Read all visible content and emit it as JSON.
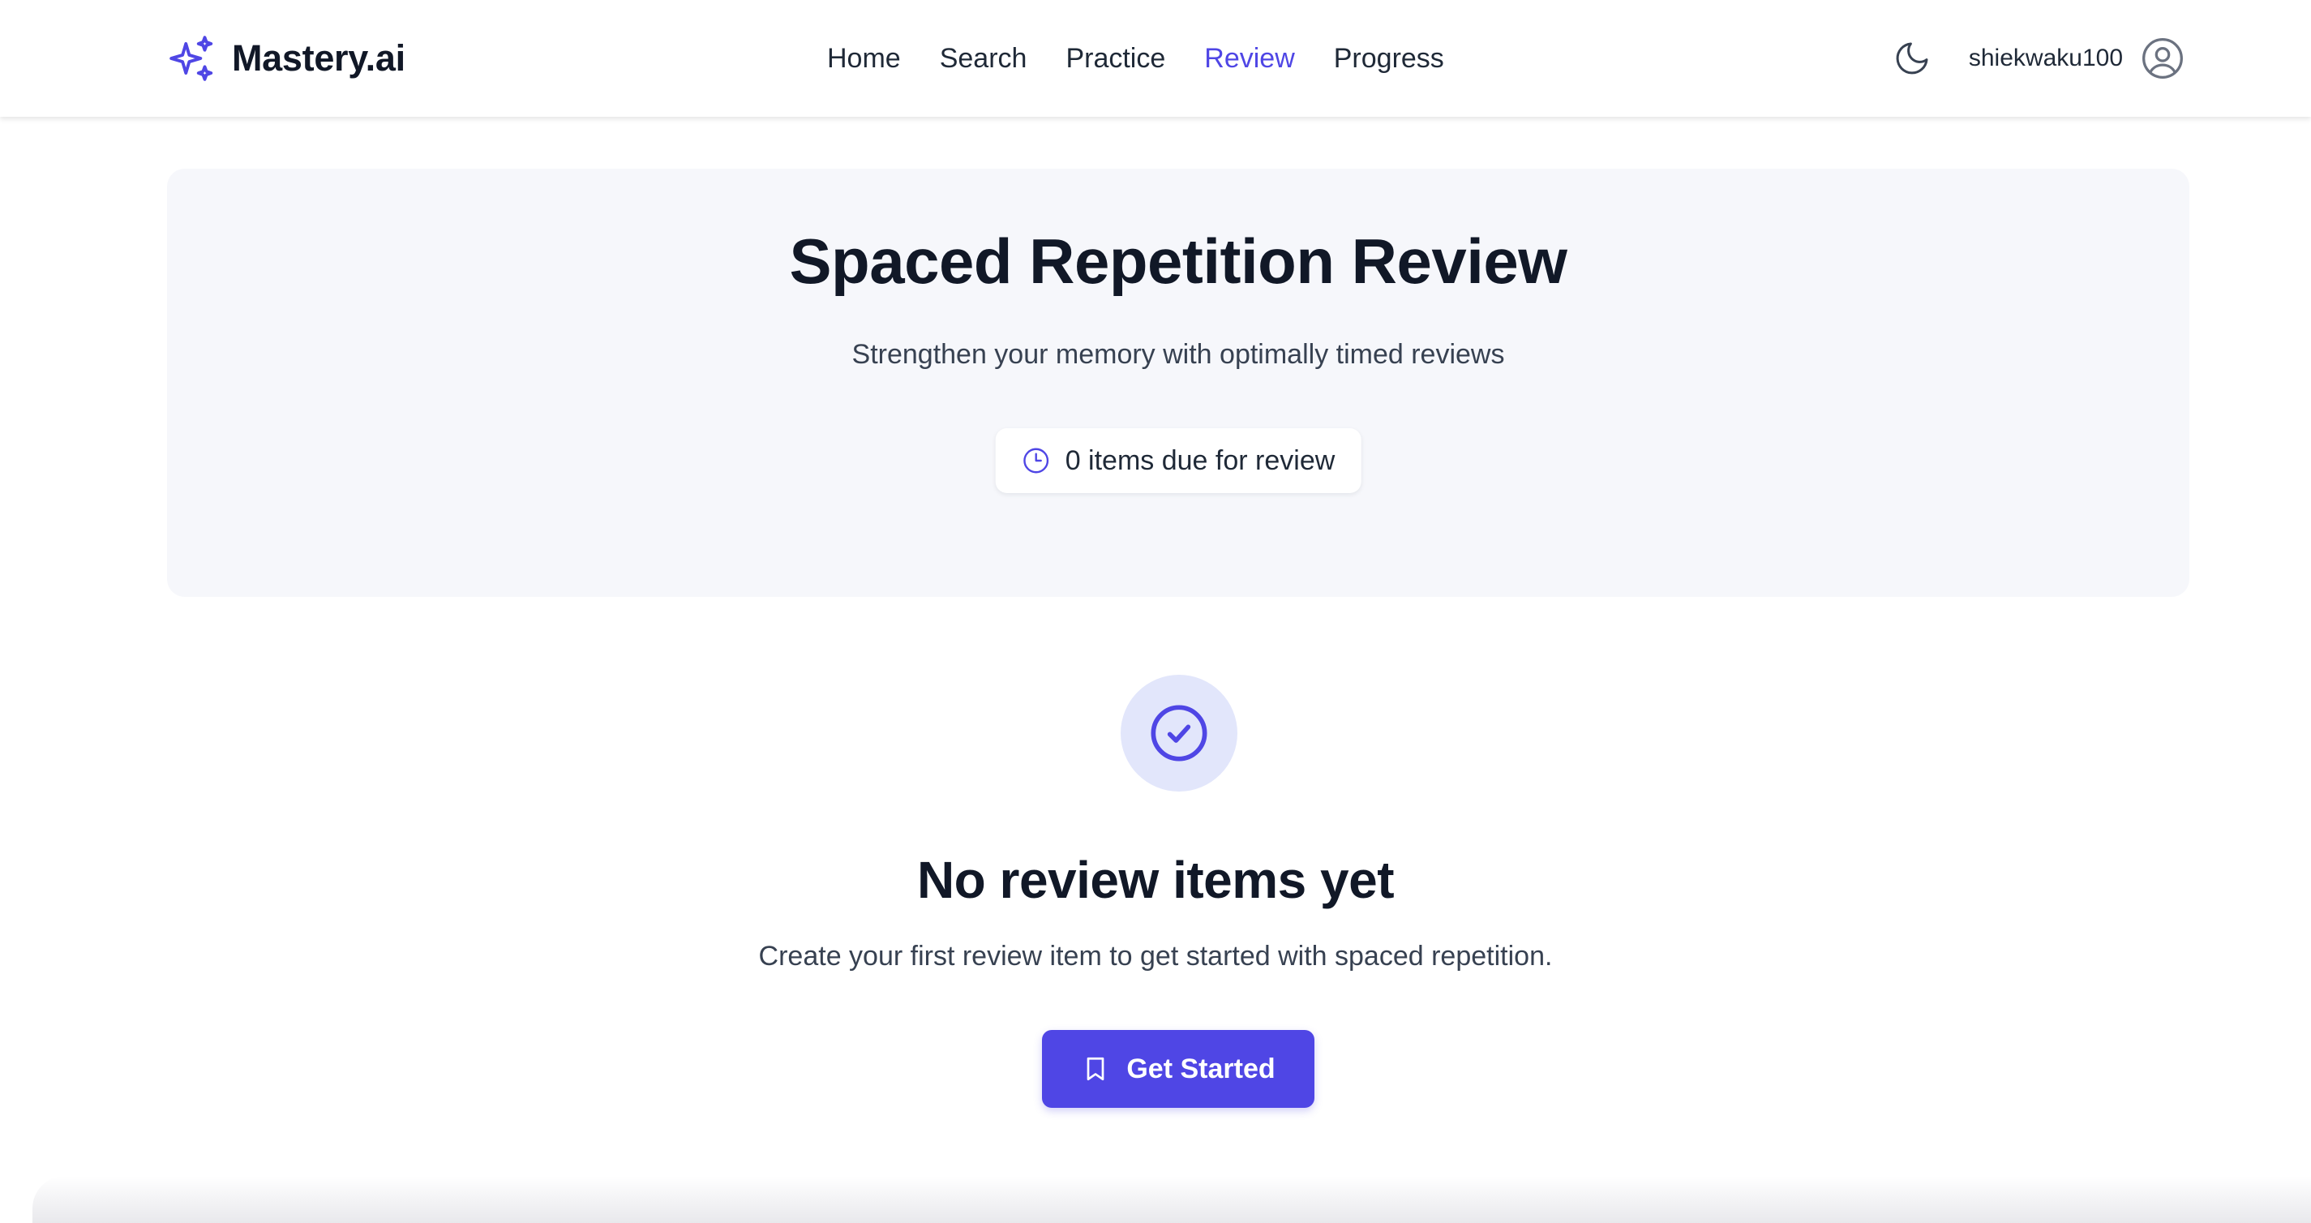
{
  "app": {
    "brand_name": "Mastery.ai",
    "brand_icon": "sparkles-icon",
    "accent_color": "#4f46e5"
  },
  "nav": {
    "links": [
      {
        "label": "Home",
        "active": false
      },
      {
        "label": "Search",
        "active": false
      },
      {
        "label": "Practice",
        "active": false
      },
      {
        "label": "Review",
        "active": true
      },
      {
        "label": "Progress",
        "active": false
      }
    ],
    "theme_toggle_icon": "moon-icon",
    "username": "shiekwaku100",
    "avatar_icon": "user-circle-icon"
  },
  "hero": {
    "title": "Spaced Repetition Review",
    "subtitle": "Strengthen your memory with optimally timed reviews",
    "due_icon": "clock-icon",
    "due_text": "0 items due for review"
  },
  "empty_state": {
    "icon": "check-circle-icon",
    "title": "No review items yet",
    "description": "Create your first review item to get started with spaced repetition.",
    "button_icon": "bookmark-icon",
    "button_label": "Get Started"
  }
}
